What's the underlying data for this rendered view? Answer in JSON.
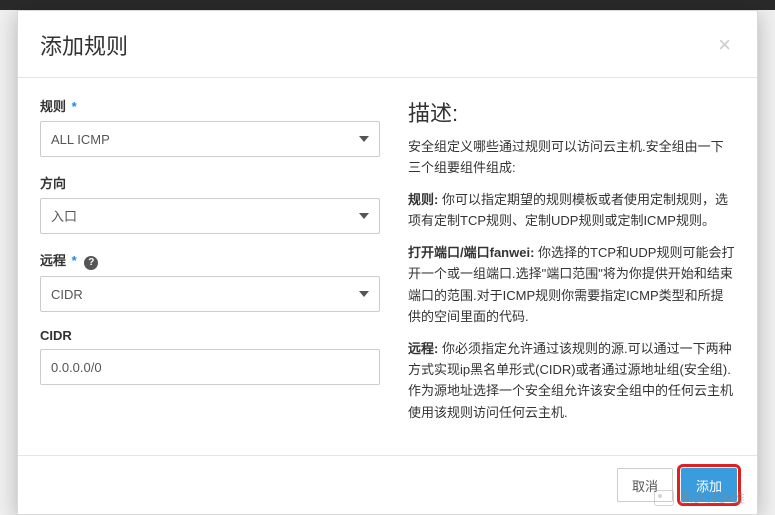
{
  "modal": {
    "title": "添加规则",
    "closeGlyph": "×"
  },
  "form": {
    "ruleLabel": "规则",
    "ruleValue": "ALL ICMP",
    "directionLabel": "方向",
    "directionValue": "入口",
    "remoteLabel": "远程",
    "remoteValue": "CIDR",
    "cidrLabel": "CIDR",
    "cidrValue": "0.0.0.0/0",
    "requiredStar": "*",
    "helpGlyph": "?"
  },
  "description": {
    "heading": "描述:",
    "intro": "安全组定义哪些通过规则可以访问云主机.安全组由一下三个组要组件组成:",
    "ruleLabel": "规则:",
    "ruleText": " 你可以指定期望的规则模板或者使用定制规则，选项有定制TCP规则、定制UDP规则或定制ICMP规则。",
    "portLabel": "打开端口/端口fanwei:",
    "portText": " 你选择的TCP和UDP规则可能会打开一个或一组端口.选择\"端口范围\"将为你提供开始和结束端口的范围.对于ICMP规则你需要指定ICMP类型和所提供的空间里面的代码.",
    "remoteLabel": "远程:",
    "remoteText": " 你必须指定允许通过该规则的源.可以通过一下两种方式实现ip黑名单形式(CIDR)或者通过源地址组(安全组).作为源地址选择一个安全组允许该安全组中的任何云主机使用该规则访问任何云主机."
  },
  "footer": {
    "cancel": "取消",
    "submit": "添加"
  },
  "watermark": {
    "text": "鹏达师运维"
  }
}
